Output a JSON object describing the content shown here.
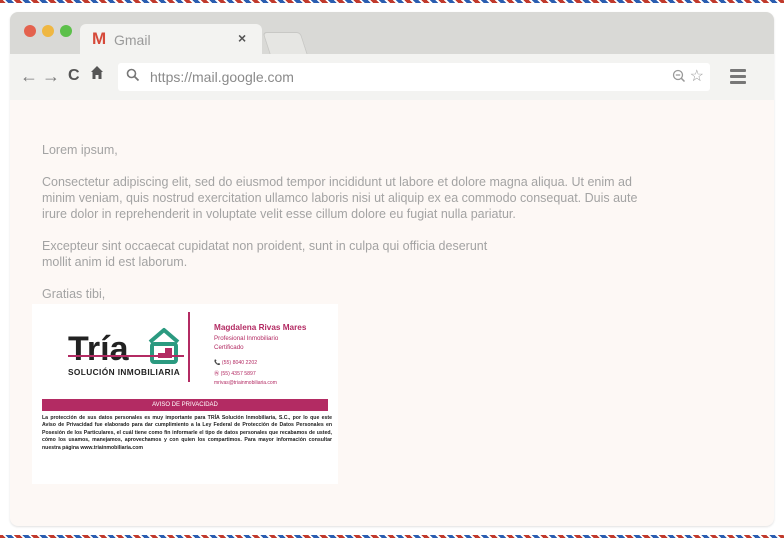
{
  "browser": {
    "tab": {
      "logo": "M",
      "title": "Gmail",
      "close": "×"
    },
    "nav": {
      "back": "←",
      "forward": "→",
      "reload": "C",
      "home": "🏠"
    },
    "url": "https://mail.google.com",
    "star": "☆"
  },
  "email": {
    "greeting": "Lorem ipsum,",
    "paragraph1": "Consectetur adipiscing elit, sed do eiusmod tempor incididunt ut labore et dolore magna aliqua. Ut enim ad minim veniam, quis nostrud exercitation ullamco laboris nisi ut aliquip ex ea commodo consequat. Duis aute irure dolor in reprehenderit in voluptate velit esse cillum dolore eu fugiat nulla pariatur.",
    "paragraph2": "Excepteur sint occaecat cupidatat non proident, sunt in culpa qui officia deserunt mollit anim id est laborum.",
    "closing": "Gratias tibi,"
  },
  "signature": {
    "logo_text": "Tría",
    "company": "SOLUCIÓN INMOBILIARIA",
    "name": "Magdalena Rivas Mares",
    "title_line1": "Profesional Inmobiliario",
    "title_line2": "Certificado",
    "phone": "📞 (55) 8040 2202",
    "whatsapp": "Ⓦ (55) 4357 5897",
    "email": "mrivas@triainmobiliaria.com",
    "privacy_label": "AVISO DE PRIVACIDAD",
    "privacy_text": "La protección de sus datos personales es muy importante para TRÍA Solución Inmobiliaria, S.C., por lo que este Aviso de Privacidad fue elaborado para dar cumplimiento a la Ley Federal de Protección de Datos Personales en Posesión de los Particulares, el cuál tiene como fin informarle el tipo de datos personales que recabamos de usted, cómo los usamos, manejamos, aprovechamos y con quien los compartimos. Para mayor información consultar nuestra página www.triainmobiliaria.com"
  },
  "colors": {
    "accent": "#b32b63",
    "logo_teal": "#2b9a80",
    "text_gray": "#a3a3a3"
  }
}
